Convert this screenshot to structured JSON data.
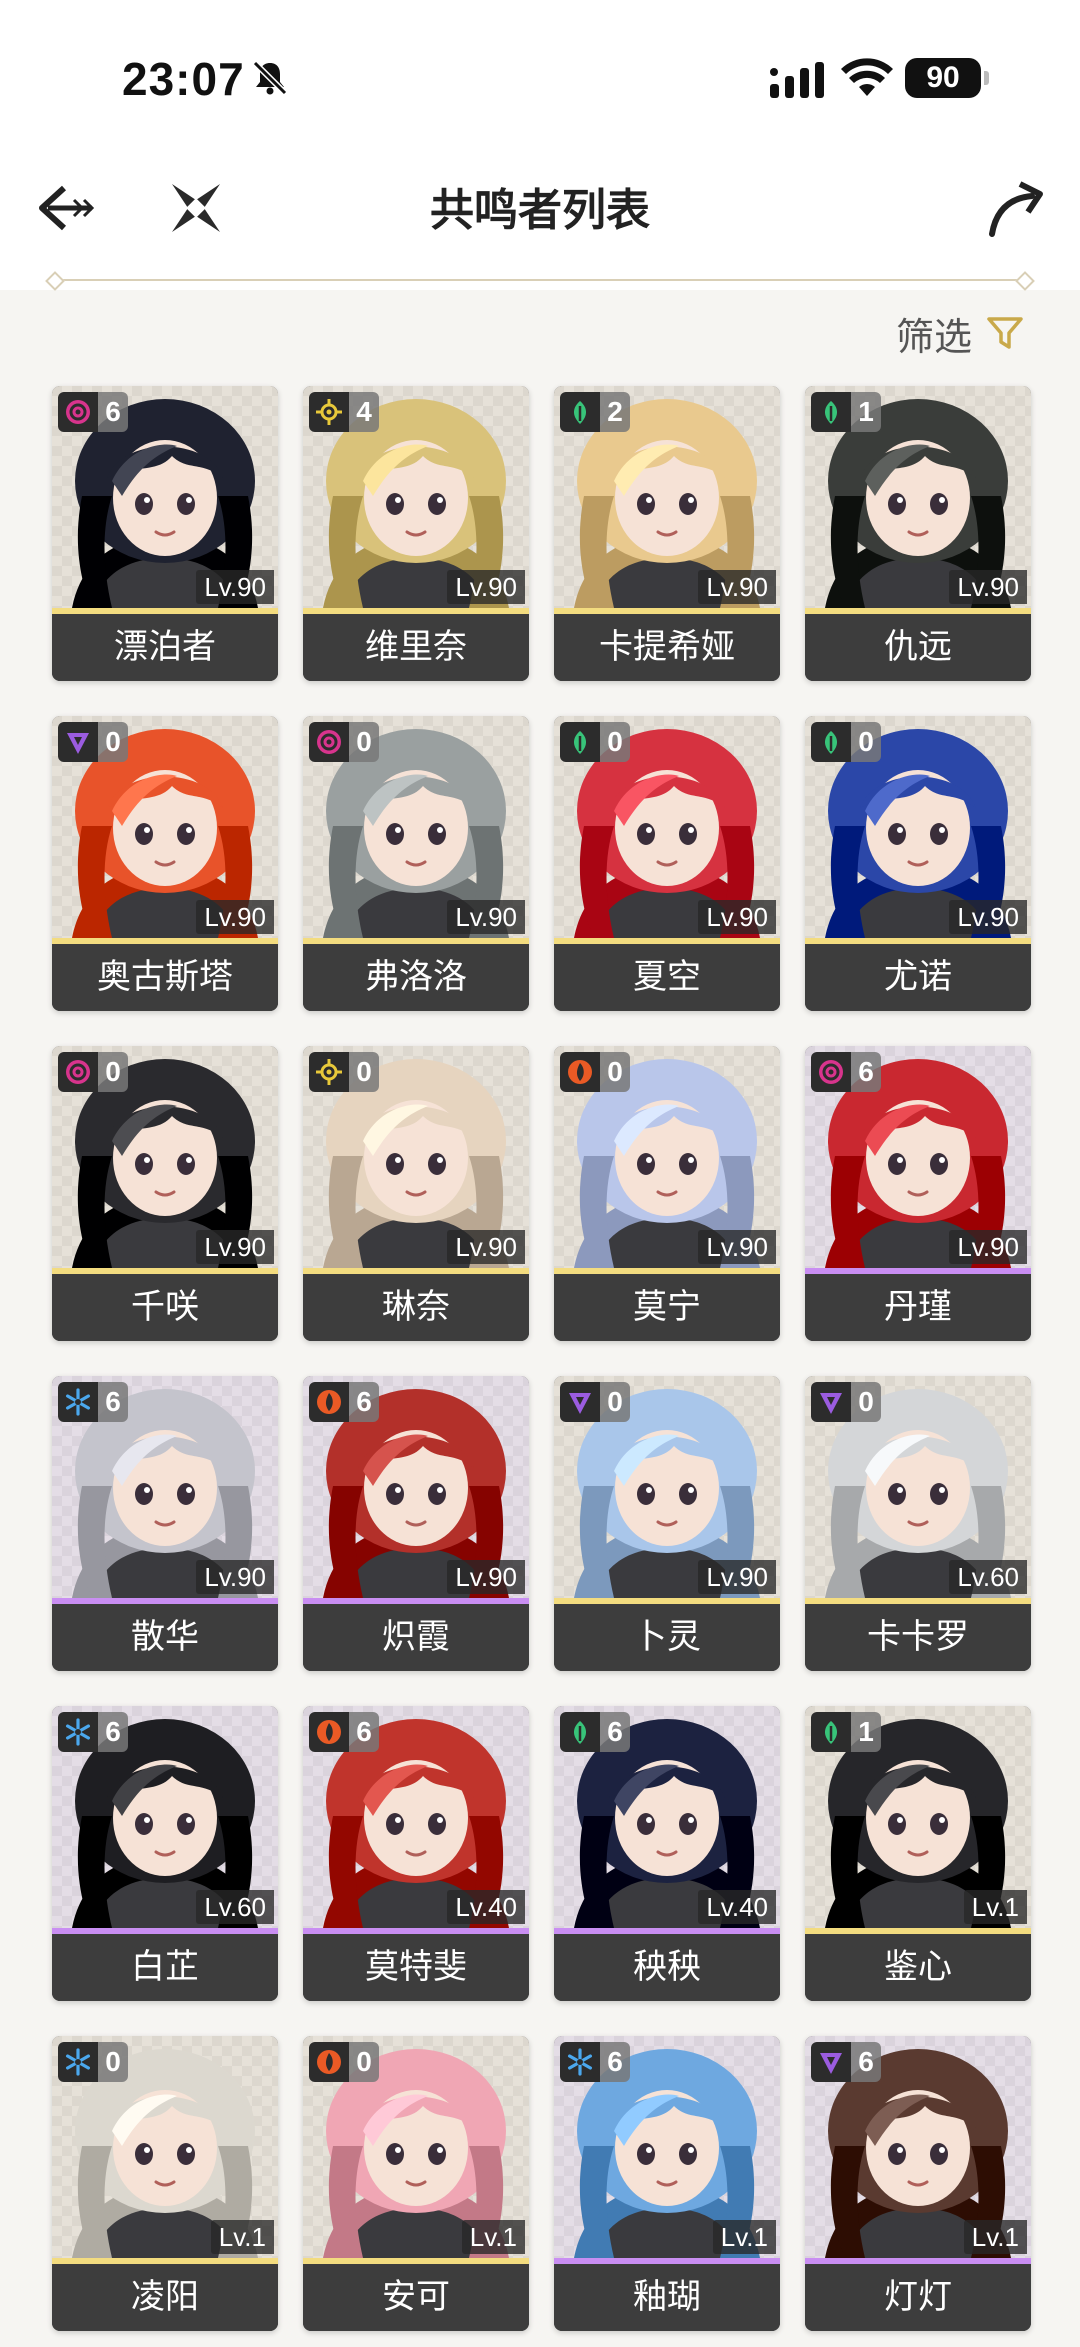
{
  "status": {
    "time": "23:07",
    "battery": "90"
  },
  "header": {
    "title": "共鸣者列表"
  },
  "filter": {
    "label": "筛选"
  },
  "colors": {
    "gold": "#f3dc7f",
    "purple": "#c98ef2",
    "background": "#f6f5f2"
  },
  "characters": [
    {
      "name": "漂泊者",
      "level": "Lv.90",
      "cons": "6",
      "element": "havoc",
      "rarity": 5,
      "hair": "#1f2230"
    },
    {
      "name": "维里奈",
      "level": "Lv.90",
      "cons": "4",
      "element": "spectro",
      "rarity": 5,
      "hair": "#d9c27a"
    },
    {
      "name": "卡提希娅",
      "level": "Lv.90",
      "cons": "2",
      "element": "aero",
      "rarity": 5,
      "hair": "#e9c98e"
    },
    {
      "name": "仇远",
      "level": "Lv.90",
      "cons": "1",
      "element": "aero",
      "rarity": 5,
      "hair": "#3a3d3a"
    },
    {
      "name": "奥古斯塔",
      "level": "Lv.90",
      "cons": "0",
      "element": "electro",
      "rarity": 5,
      "hair": "#e8532a"
    },
    {
      "name": "弗洛洛",
      "level": "Lv.90",
      "cons": "0",
      "element": "havoc",
      "rarity": 5,
      "hair": "#9aa0a0"
    },
    {
      "name": "夏空",
      "level": "Lv.90",
      "cons": "0",
      "element": "aero",
      "rarity": 5,
      "hair": "#d63240"
    },
    {
      "name": "尤诺",
      "level": "Lv.90",
      "cons": "0",
      "element": "aero",
      "rarity": 5,
      "hair": "#2b47a8"
    },
    {
      "name": "千咲",
      "level": "Lv.90",
      "cons": "0",
      "element": "havoc",
      "rarity": 5,
      "hair": "#2a2a2e"
    },
    {
      "name": "琳奈",
      "level": "Lv.90",
      "cons": "0",
      "element": "spectro",
      "rarity": 5,
      "hair": "#e6d4bf"
    },
    {
      "name": "莫宁",
      "level": "Lv.90",
      "cons": "0",
      "element": "fusion",
      "rarity": 5,
      "hair": "#b9c6ea"
    },
    {
      "name": "丹瑾",
      "level": "Lv.90",
      "cons": "6",
      "element": "havoc",
      "rarity": 4,
      "hair": "#c92830"
    },
    {
      "name": "散华",
      "level": "Lv.90",
      "cons": "6",
      "element": "glacio",
      "rarity": 4,
      "hair": "#c4c4cc"
    },
    {
      "name": "炽霞",
      "level": "Lv.90",
      "cons": "6",
      "element": "fusion",
      "rarity": 4,
      "hair": "#b3302a"
    },
    {
      "name": "卜灵",
      "level": "Lv.90",
      "cons": "0",
      "element": "electro",
      "rarity": 5,
      "hair": "#a9c6ea"
    },
    {
      "name": "卡卡罗",
      "level": "Lv.60",
      "cons": "0",
      "element": "electro",
      "rarity": 5,
      "hair": "#d4d6d8"
    },
    {
      "name": "白芷",
      "level": "Lv.60",
      "cons": "6",
      "element": "glacio",
      "rarity": 4,
      "hair": "#1e1e22"
    },
    {
      "name": "莫特斐",
      "level": "Lv.40",
      "cons": "6",
      "element": "fusion",
      "rarity": 4,
      "hair": "#c0342c"
    },
    {
      "name": "秧秧",
      "level": "Lv.40",
      "cons": "6",
      "element": "aero",
      "rarity": 4,
      "hair": "#1c2240"
    },
    {
      "name": "鉴心",
      "level": "Lv.1",
      "cons": "1",
      "element": "aero",
      "rarity": 5,
      "hair": "#26262a"
    },
    {
      "name": "凌阳",
      "level": "Lv.1",
      "cons": "0",
      "element": "glacio",
      "rarity": 5,
      "hair": "#dcd8cf"
    },
    {
      "name": "安可",
      "level": "Lv.1",
      "cons": "0",
      "element": "fusion",
      "rarity": 5,
      "hair": "#f0a6b4"
    },
    {
      "name": "釉瑚",
      "level": "Lv.1",
      "cons": "6",
      "element": "glacio",
      "rarity": 4,
      "hair": "#6ea8e0"
    },
    {
      "name": "灯灯",
      "level": "Lv.1",
      "cons": "6",
      "element": "electro",
      "rarity": 4,
      "hair": "#5a3a30"
    }
  ]
}
